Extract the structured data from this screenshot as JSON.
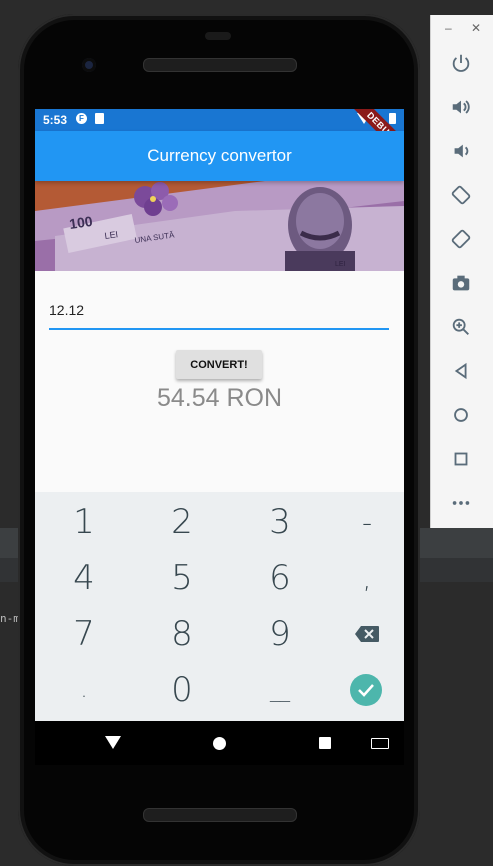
{
  "ide": {
    "console_fragment": "n-m"
  },
  "toolbar": {
    "minimize_label": "–",
    "close_label": "✕",
    "buttons": [
      "power",
      "volume-up",
      "volume-down",
      "rotate-left",
      "rotate-right",
      "screenshot",
      "zoom",
      "back",
      "home",
      "overview",
      "more"
    ]
  },
  "status": {
    "time": "5:53",
    "debug_label": "DEBUG"
  },
  "appbar": {
    "title": "Currency convertor"
  },
  "form": {
    "amount_value": "12.12",
    "convert_label": "CONVERT!",
    "result_text": "54.54 RON"
  },
  "keyboard": {
    "keys": [
      [
        "1",
        "2",
        "3",
        "-"
      ],
      [
        "4",
        "5",
        "6",
        ","
      ],
      [
        "7",
        "8",
        "9",
        "backspace"
      ],
      [
        ".",
        "0",
        "_",
        "done"
      ]
    ],
    "labels": {
      "k1": "1",
      "k2": "2",
      "k3": "3",
      "kminus": "-",
      "k4": "4",
      "k5": "5",
      "k6": "6",
      "kcomma": ",",
      "k7": "7",
      "k8": "8",
      "k9": "9",
      "kdot": ".",
      "k0": "0",
      "kspace": "__"
    }
  },
  "colors": {
    "appbar": "#2196f3",
    "statusbar": "#1976d2",
    "accent_check": "#4db6ac"
  }
}
